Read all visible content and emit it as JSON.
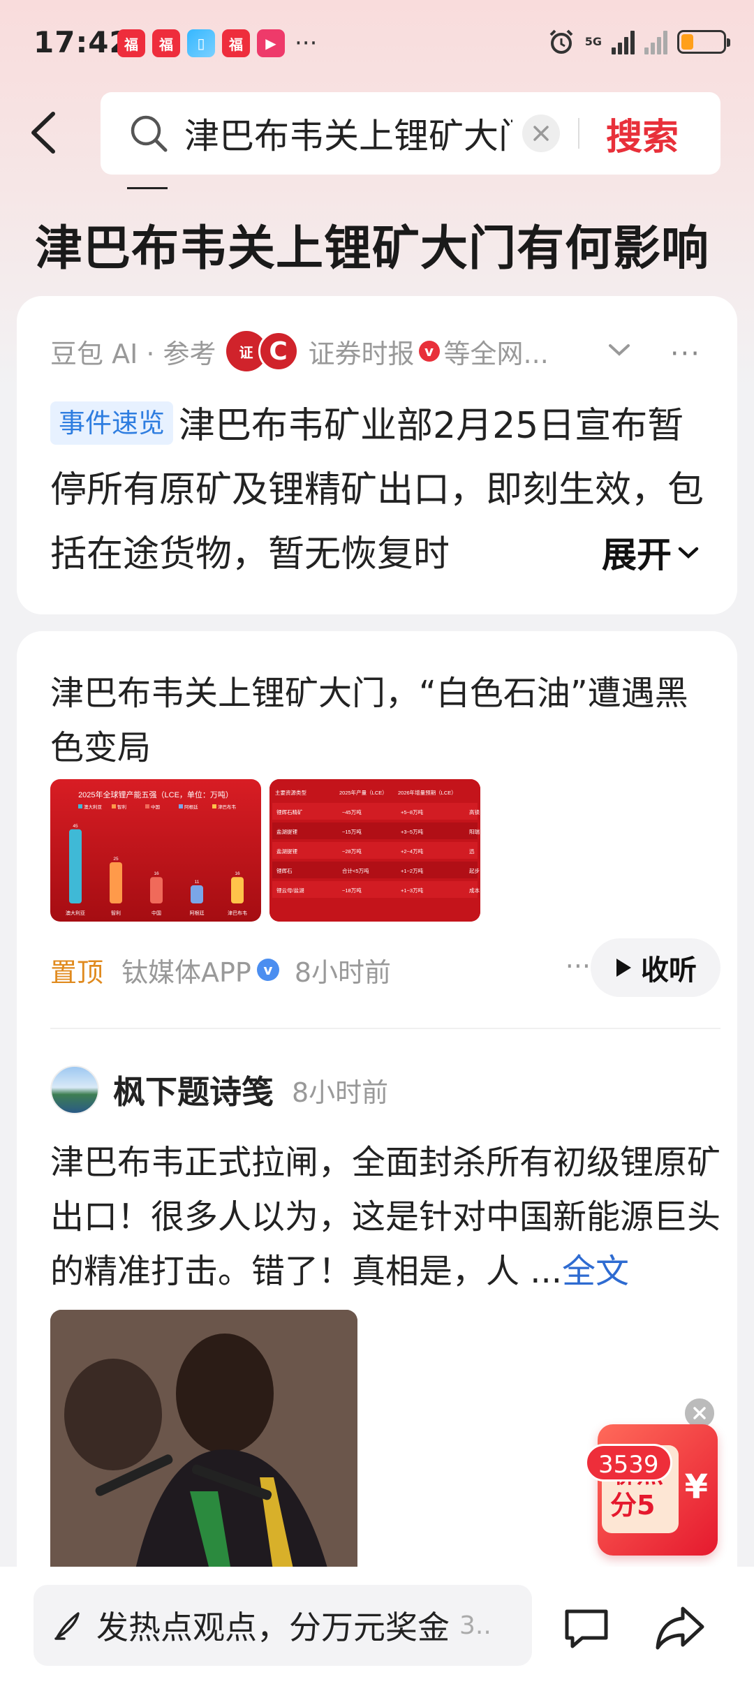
{
  "status_bar": {
    "time": "17:42",
    "notifications": [
      "红包",
      "红包",
      "书",
      "红包",
      "视频"
    ],
    "more": "···",
    "network": "5G",
    "battery_level": 0.3
  },
  "search": {
    "query": "津巴布韦关上锂矿大门有何影响",
    "button_label": "搜索"
  },
  "page_title": "津巴布韦关上锂矿大门有何影响",
  "ai_summary": {
    "source_label": "豆包 AI · 参考",
    "source_name": "证券时报",
    "source_suffix": "等全网...",
    "tag": "事件速览",
    "text": "津巴布韦矿业部2月25日宣布暂停所有原矿及锂精矿出口，即刻生效，包括在途货物，暂无恢复时",
    "expand_label": "展开"
  },
  "news_item": {
    "title": "津巴布韦关上锂矿大门，“白色石油”遭遇黑色变局",
    "pin_label": "置顶",
    "source": "钛媒体APP",
    "time": "8小时前",
    "listen_label": "收听",
    "thumb1": {
      "title": "2025年全球锂产能五强（LCE，单位：万吨）",
      "legend": [
        "澳大利亚",
        "智利",
        "中国",
        "阿根廷",
        "津巴布韦"
      ],
      "values": [
        45,
        25,
        16,
        11,
        16
      ],
      "value_labels": [
        "45",
        "25",
        "16",
        "11",
        "16"
      ],
      "colors": [
        "#3fb9d6",
        "#ff9a4a",
        "#f06a5a",
        "#7aa6e8",
        "#ffc34a"
      ]
    },
    "thumb2": {
      "headers": [
        "主要资源类型",
        "2025年产量（LCE）",
        "2026年增量预期（LCE）",
        ""
      ],
      "rows": [
        [
          "锂辉石精矿",
          "~45万吨",
          "+5~8万吨",
          "高锁"
        ],
        [
          "盐湖提锂",
          "~15万吨",
          "+3~5万吨",
          "阳瑞"
        ],
        [
          "盐湖提锂",
          "~28万吨",
          "+2~4万吨",
          "迅"
        ],
        [
          "锂辉石",
          "合计<5万吨",
          "+1~2万吨",
          "起步"
        ],
        [
          "锂云母/盐湖",
          "~18万吨",
          "+1~3万吨",
          "成本"
        ]
      ]
    }
  },
  "post": {
    "author": "枫下题诗笺",
    "time": "8小时前",
    "text": "津巴布韦正式拉闸，全面封杀所有初级锂原矿出口！很多人以为，这是针对中国新能源巨头的精准打击。错了！真相是，人 ...",
    "fulltext_label": "全文"
  },
  "promo": {
    "line1": "聊热",
    "line2": "分5",
    "symbol": "¥"
  },
  "bottom_bar": {
    "comment_placeholder": "发热点观点，分万元奖金",
    "comment_more": "3..",
    "comment_count": "3539"
  }
}
